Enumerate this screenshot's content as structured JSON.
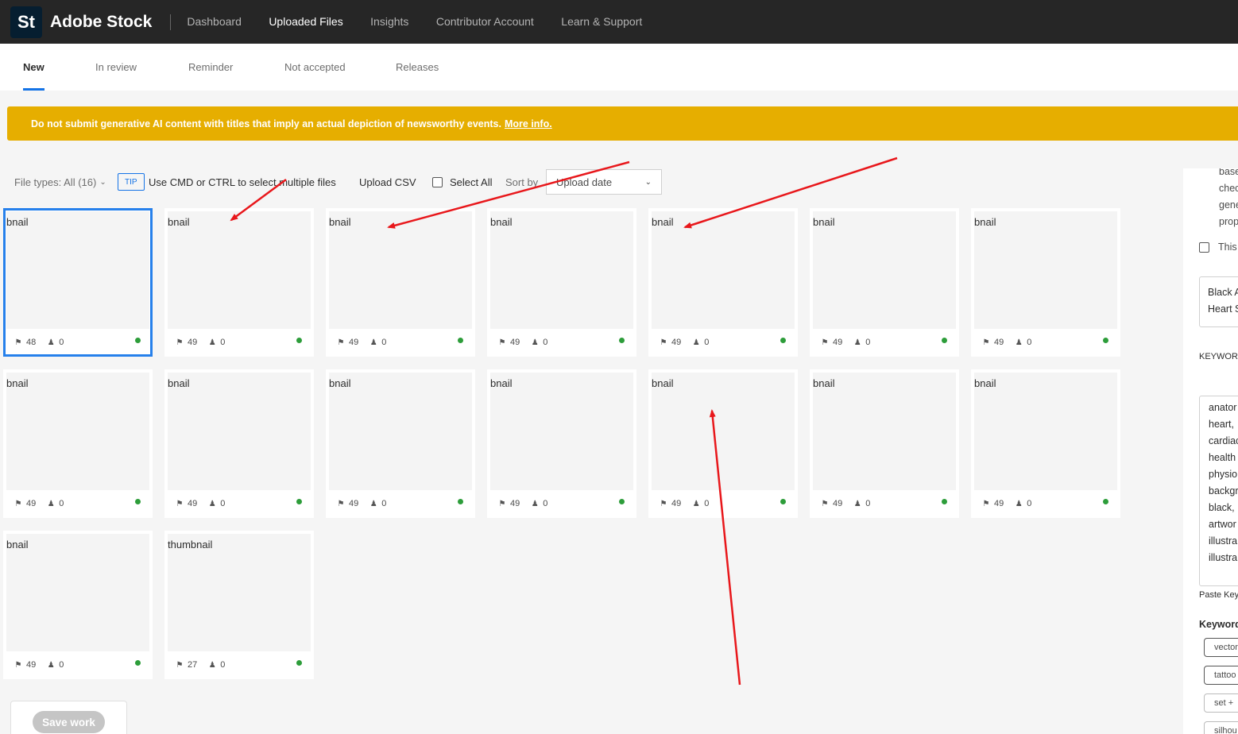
{
  "app": {
    "logo_text": "St",
    "title": "Adobe Stock"
  },
  "nav": [
    {
      "label": "Dashboard",
      "active": false
    },
    {
      "label": "Uploaded Files",
      "active": true
    },
    {
      "label": "Insights",
      "active": false
    },
    {
      "label": "Contributor Account",
      "active": false
    },
    {
      "label": "Learn & Support",
      "active": false
    }
  ],
  "tabs": [
    {
      "label": "New",
      "active": true
    },
    {
      "label": "In review",
      "active": false
    },
    {
      "label": "Reminder",
      "active": false
    },
    {
      "label": "Not accepted",
      "active": false
    },
    {
      "label": "Releases",
      "active": false
    }
  ],
  "banner": {
    "text": "Do not submit generative AI content with titles that imply an actual depiction of newsworthy events.",
    "link": "More info.",
    "color": "#e6ae00"
  },
  "toolbar": {
    "file_types": "File types: All (16)",
    "tip_badge": "TIP",
    "tip_text": "Use CMD or CTRL to select multiple files",
    "upload_csv": "Upload CSV",
    "select_all": "Select All",
    "sort_by": "Sort by",
    "sort_value": "Upload date"
  },
  "files": [
    {
      "alt": "bnail",
      "keywords": "48",
      "releases": "0",
      "selected": true
    },
    {
      "alt": "bnail",
      "keywords": "49",
      "releases": "0"
    },
    {
      "alt": "bnail",
      "keywords": "49",
      "releases": "0"
    },
    {
      "alt": "bnail",
      "keywords": "49",
      "releases": "0"
    },
    {
      "alt": "bnail",
      "keywords": "49",
      "releases": "0"
    },
    {
      "alt": "bnail",
      "keywords": "49",
      "releases": "0"
    },
    {
      "alt": "bnail",
      "keywords": "49",
      "releases": "0"
    },
    {
      "alt": "bnail",
      "keywords": "49",
      "releases": "0"
    },
    {
      "alt": "bnail",
      "keywords": "49",
      "releases": "0"
    },
    {
      "alt": "bnail",
      "keywords": "49",
      "releases": "0"
    },
    {
      "alt": "bnail",
      "keywords": "49",
      "releases": "0"
    },
    {
      "alt": "bnail",
      "keywords": "49",
      "releases": "0"
    },
    {
      "alt": "bnail",
      "keywords": "49",
      "releases": "0"
    },
    {
      "alt": "bnail",
      "keywords": "49",
      "releases": "0"
    },
    {
      "alt": "bnail",
      "keywords": "49",
      "releases": "0"
    },
    {
      "alt": "thumbnail",
      "keywords": "27",
      "releases": "0"
    }
  ],
  "save_button": "Save work",
  "right_panel": {
    "ai_text_lines": [
      "base",
      "chec",
      "gene",
      "prop"
    ],
    "checkbox_label": "This",
    "title_lines": [
      "Black A",
      "Heart S"
    ],
    "keywords_label": "KEYWORD",
    "keywords_lines": [
      "anator",
      "heart,",
      "cardiac",
      "health",
      "physio",
      "backgr",
      "black,",
      "artwor",
      "illustra",
      "illustra"
    ],
    "paste_label": "Paste Keyw",
    "suggested_label": "Keyword",
    "chips": [
      "vector",
      "tattoo",
      "set  +",
      "silhou"
    ]
  }
}
